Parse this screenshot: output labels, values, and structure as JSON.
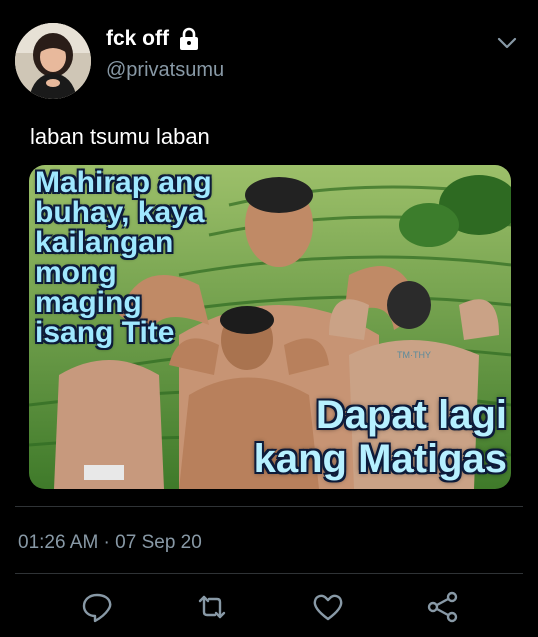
{
  "user": {
    "display_name": "fck off",
    "handle": "@privatsumu",
    "protected_icon": "lock-icon"
  },
  "tweet": {
    "text": "laban tsumu laban",
    "timestamp": "01:26 AM · 07 Sep 20"
  },
  "media": {
    "top_lines": [
      "Mahirap ang",
      "buhay, kaya",
      "kailangan",
      "mong",
      "maging",
      "isang Tite"
    ],
    "bottom_lines": [
      "Dapat lagi",
      "kang Matigas"
    ],
    "tattoo_text": "TM·THY"
  },
  "actions": {
    "reply_icon": "reply-icon",
    "retweet_icon": "retweet-icon",
    "like_icon": "heart-icon",
    "share_icon": "share-icon"
  },
  "colors": {
    "background": "#000000",
    "secondary_text": "#8899a6",
    "divider": "#2f3336"
  }
}
